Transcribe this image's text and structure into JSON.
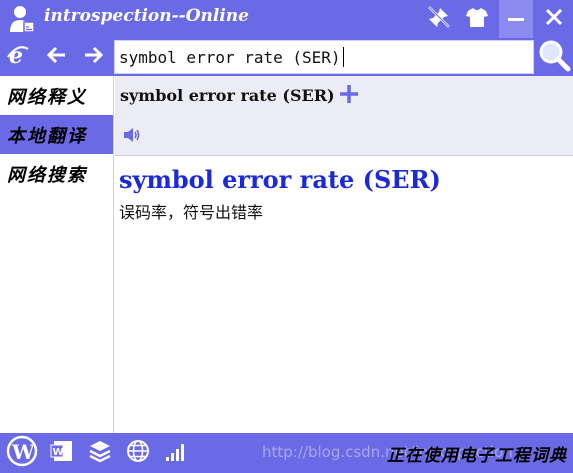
{
  "window": {
    "title": "introspection--Online"
  },
  "search": {
    "query": "symbol error rate (SER)"
  },
  "sidebar": {
    "items": [
      {
        "label": "网络释义"
      },
      {
        "label": "本地翻译"
      },
      {
        "label": "网络搜索"
      }
    ]
  },
  "header": {
    "word": "symbol error rate (SER)"
  },
  "entry": {
    "word": "symbol error rate (SER)",
    "definition": "误码率，符号出错率"
  },
  "status": {
    "text": "正在使用电子工程词典",
    "watermark": "http://blog.csdn.net/introspection"
  },
  "colors": {
    "accent": "#6a6ae6",
    "entry_word": "#1a2ad8"
  }
}
